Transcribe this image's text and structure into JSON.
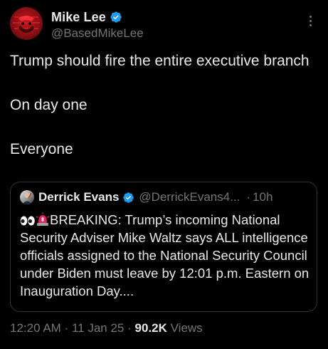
{
  "author": {
    "display_name": "Mike Lee",
    "handle": "@BasedMikeLee",
    "verified": true,
    "verified_color": "#1d9bf0"
  },
  "tweet": {
    "lines": [
      "Trump should fire the entire executive branch",
      "On day one",
      "Everyone"
    ]
  },
  "quote": {
    "display_name": "Derrick Evans",
    "handle": "@DerrickEvans4...",
    "separator": "·",
    "time": "10h",
    "emojis": [
      "eyes-emoji",
      "siren-emoji"
    ],
    "text": "BREAKING: Trump’s incoming National Security Adviser Mike Waltz says ALL intelligence officials assigned to the National Security Council under Biden must leave by 12:01 p.m. Eastern on Inauguration Day...."
  },
  "meta": {
    "time": "12:20 AM",
    "separator1": "·",
    "date": "11 Jan 25",
    "separator2": "·",
    "views_count": "90.2K",
    "views_label": "Views"
  },
  "colors": {
    "background": "#000000",
    "text": "#e7e9ea",
    "muted": "#71767b",
    "border": "#2f3336"
  },
  "icons": {
    "more": "more-vertical-icon",
    "verified": "verified-badge-icon"
  }
}
